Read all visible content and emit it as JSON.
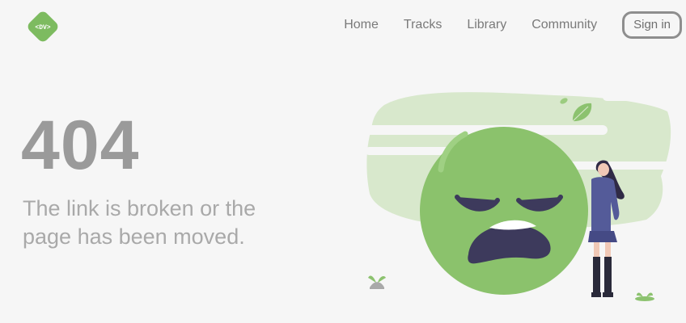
{
  "header": {
    "logo_text": "<DV>",
    "nav": [
      {
        "label": "Home"
      },
      {
        "label": "Tracks"
      },
      {
        "label": "Library"
      },
      {
        "label": "Community"
      }
    ],
    "signin_label": "Sign in"
  },
  "error": {
    "code": "404",
    "message": "The link is broken or the page has been moved."
  },
  "colors": {
    "background": "#f6f6f6",
    "brand_green": "#8cc26f",
    "text_gray": "#9a9a9a",
    "nav_gray": "#7a7a7a"
  },
  "icons": [
    "logo-icon",
    "sad-face-icon",
    "leaf-icon",
    "sprout-icon"
  ]
}
